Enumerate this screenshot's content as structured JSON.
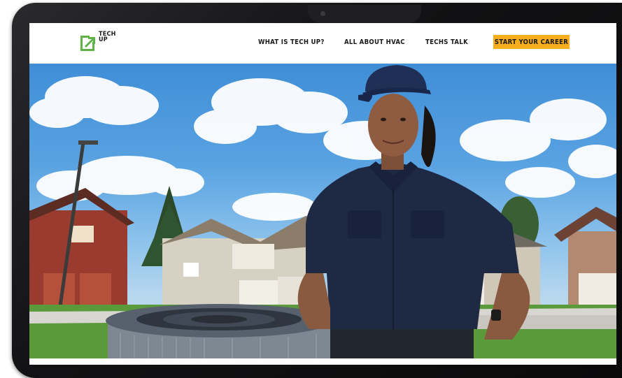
{
  "brand": {
    "logo_line1": "TECH",
    "logo_line2": "UP",
    "logo_color": "#5fb246",
    "logo_icon": "arrow-up-right-icon"
  },
  "nav": {
    "items": [
      {
        "label": "WHAT IS TECH UP?"
      },
      {
        "label": "ALL ABOUT HVAC"
      },
      {
        "label": "TECHS TALK"
      }
    ],
    "cta_label": "START YOUR CAREER",
    "cta_color": "#f6ad1e"
  },
  "hero": {
    "scene": "hero-photo",
    "uniform_color": "#1e2a44"
  }
}
